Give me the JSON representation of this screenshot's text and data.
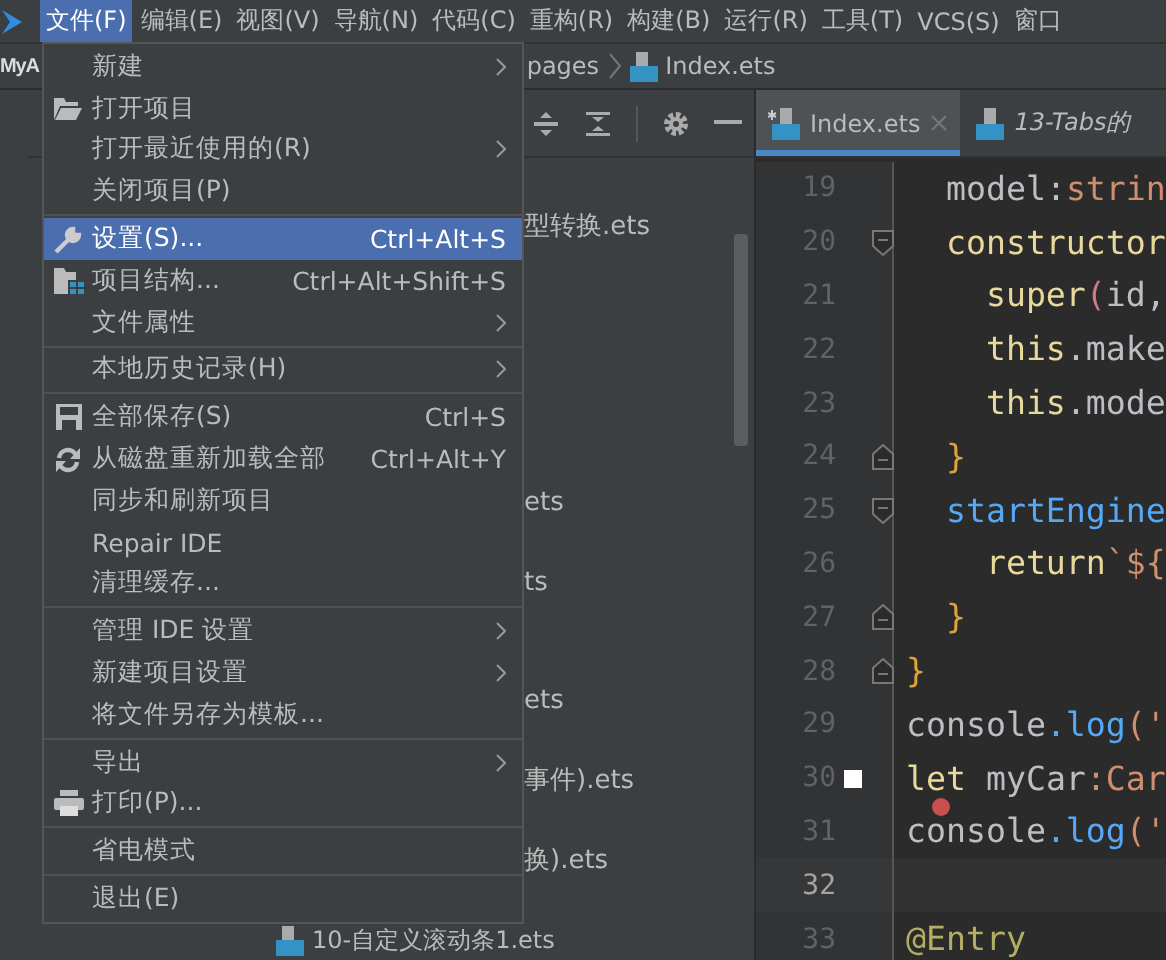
{
  "menubar": [
    {
      "label": "文件(F)",
      "selected": true
    },
    {
      "label": "编辑(E)",
      "selected": false
    },
    {
      "label": "视图(V)",
      "selected": false
    },
    {
      "label": "导航(N)",
      "selected": false
    },
    {
      "label": "代码(C)",
      "selected": false
    },
    {
      "label": "重构(R)",
      "selected": false
    },
    {
      "label": "构建(B)",
      "selected": false
    },
    {
      "label": "运行(R)",
      "selected": false
    },
    {
      "label": "工具(T)",
      "selected": false
    },
    {
      "label": "VCS(S)",
      "selected": false
    },
    {
      "label": "窗口",
      "selected": false
    }
  ],
  "breadcrumb": {
    "project": "MyA",
    "folder": "pages",
    "file": "Index.ets"
  },
  "editor_tabs": [
    {
      "label": "Index.ets",
      "selected": true,
      "modified": true
    },
    {
      "label": "13-Tabs的",
      "selected": false,
      "modified": false
    }
  ],
  "project_tree": [
    {
      "label": "型转换.ets",
      "kind": "clipped"
    },
    {
      "label": "ets",
      "kind": "clipped"
    },
    {
      "label": "ts",
      "kind": "clipped"
    },
    {
      "label": "ets",
      "kind": "clipped"
    },
    {
      "label": "事件).ets",
      "kind": "clipped"
    },
    {
      "label": "换).ets",
      "kind": "clipped"
    },
    {
      "label": "10-自定义滚动条1.ets",
      "kind": "file"
    }
  ],
  "file_menu": [
    {
      "kind": "item",
      "label": "新建",
      "submenu": true,
      "selected": false
    },
    {
      "kind": "item",
      "label": "打开项目",
      "submenu": false,
      "selected": false
    },
    {
      "kind": "item",
      "label": "打开最近使用的(R)",
      "submenu": true,
      "selected": false
    },
    {
      "kind": "item",
      "label": "关闭项目(P)",
      "submenu": false,
      "selected": false
    },
    {
      "kind": "separator"
    },
    {
      "kind": "item",
      "label": "设置(S)...",
      "shortcut": "Ctrl+Alt+S",
      "submenu": false,
      "selected": true
    },
    {
      "kind": "item",
      "label": "项目结构...",
      "shortcut": "Ctrl+Alt+Shift+S",
      "submenu": false,
      "selected": false
    },
    {
      "kind": "item",
      "label": "文件属性",
      "submenu": true,
      "selected": false
    },
    {
      "kind": "separator"
    },
    {
      "kind": "item",
      "label": "本地历史记录(H)",
      "submenu": true,
      "selected": false
    },
    {
      "kind": "separator"
    },
    {
      "kind": "item",
      "label": "全部保存(S)",
      "shortcut": "Ctrl+S",
      "submenu": false,
      "selected": false
    },
    {
      "kind": "item",
      "label": "从磁盘重新加载全部",
      "shortcut": "Ctrl+Alt+Y",
      "submenu": false,
      "selected": false
    },
    {
      "kind": "item",
      "label": "同步和刷新项目",
      "submenu": false,
      "selected": false
    },
    {
      "kind": "item",
      "label": "Repair IDE",
      "submenu": false,
      "selected": false
    },
    {
      "kind": "item",
      "label": "清理缓存...",
      "submenu": false,
      "selected": false
    },
    {
      "kind": "separator"
    },
    {
      "kind": "item",
      "label": "管理 IDE 设置",
      "submenu": true,
      "selected": false
    },
    {
      "kind": "item",
      "label": "新建项目设置",
      "submenu": true,
      "selected": false
    },
    {
      "kind": "item",
      "label": "将文件另存为模板...",
      "submenu": false,
      "selected": false
    },
    {
      "kind": "separator"
    },
    {
      "kind": "item",
      "label": "导出",
      "submenu": true,
      "selected": false
    },
    {
      "kind": "item",
      "label": "打印(P)...",
      "submenu": false,
      "selected": false
    },
    {
      "kind": "separator"
    },
    {
      "kind": "item",
      "label": "省电模式",
      "submenu": false,
      "selected": false
    },
    {
      "kind": "separator"
    },
    {
      "kind": "item",
      "label": "退出(E)",
      "submenu": false,
      "selected": false
    }
  ],
  "code_lines": [
    {
      "number": "19",
      "current": false,
      "fold_start": false,
      "fold_end": false,
      "tokens": [
        {
          "text": "  model",
          "kind": "plain"
        },
        {
          "text": ":",
          "kind": "plain"
        },
        {
          "text": "strin",
          "kind": "type"
        }
      ]
    },
    {
      "number": "20",
      "current": false,
      "fold_start": true,
      "fold_end": false,
      "tokens": [
        {
          "text": "  constructor",
          "kind": "keyword"
        }
      ]
    },
    {
      "number": "21",
      "current": false,
      "fold_start": false,
      "fold_end": false,
      "tokens": [
        {
          "text": "    super",
          "kind": "keyword"
        },
        {
          "text": "(",
          "kind": "paren"
        },
        {
          "text": "id,",
          "kind": "plain"
        }
      ]
    },
    {
      "number": "22",
      "current": false,
      "fold_start": false,
      "fold_end": false,
      "tokens": [
        {
          "text": "    this",
          "kind": "keyword"
        },
        {
          "text": ".make",
          "kind": "plain"
        }
      ]
    },
    {
      "number": "23",
      "current": false,
      "fold_start": false,
      "fold_end": false,
      "tokens": [
        {
          "text": "    this",
          "kind": "keyword"
        },
        {
          "text": ".mode",
          "kind": "plain"
        }
      ]
    },
    {
      "number": "24",
      "current": false,
      "fold_start": false,
      "fold_end": true,
      "tokens": [
        {
          "text": "  }",
          "kind": "brace"
        }
      ]
    },
    {
      "number": "25",
      "current": false,
      "fold_start": true,
      "fold_end": false,
      "tokens": [
        {
          "text": "  startEngine",
          "kind": "func"
        }
      ]
    },
    {
      "number": "26",
      "current": false,
      "fold_start": false,
      "fold_end": false,
      "tokens": [
        {
          "text": "    return",
          "kind": "keyword"
        },
        {
          "text": "`${",
          "kind": "type"
        }
      ]
    },
    {
      "number": "27",
      "current": false,
      "fold_start": false,
      "fold_end": true,
      "tokens": [
        {
          "text": "  }",
          "kind": "brace"
        }
      ]
    },
    {
      "number": "28",
      "current": false,
      "fold_start": false,
      "fold_end": true,
      "tokens": [
        {
          "text": "}",
          "kind": "brace"
        }
      ]
    },
    {
      "number": "29",
      "current": false,
      "fold_start": false,
      "fold_end": false,
      "tokens": [
        {
          "text": "console",
          "kind": "plain"
        },
        {
          "text": ".log",
          "kind": "func"
        },
        {
          "text": "('",
          "kind": "type"
        }
      ]
    },
    {
      "number": "30",
      "current": false,
      "fold_start": false,
      "fold_end": false,
      "bookmark": true,
      "tokens": [
        {
          "text": "let",
          "kind": "keyword"
        },
        {
          "text": " myCar",
          "kind": "plain"
        },
        {
          "text": ":Car",
          "kind": "type"
        }
      ]
    },
    {
      "number": "31",
      "current": false,
      "fold_start": false,
      "fold_end": false,
      "error": true,
      "tokens": [
        {
          "text": "console",
          "kind": "plain"
        },
        {
          "text": ".log",
          "kind": "func"
        },
        {
          "text": "('",
          "kind": "type"
        }
      ]
    },
    {
      "number": "32",
      "fold_start": false,
      "fold_end": false,
      "current": true
    },
    {
      "number": "33",
      "current": false,
      "fold_start": false,
      "fold_end": false,
      "tokens": [
        {
          "text": "@Entry",
          "kind": "annotation"
        }
      ]
    }
  ]
}
